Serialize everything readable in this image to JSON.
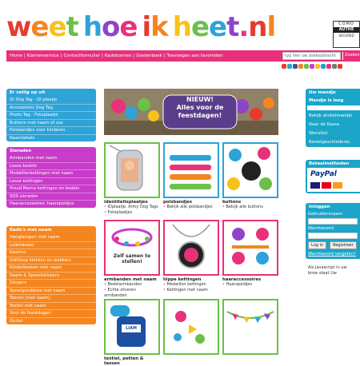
{
  "logo": {
    "letters": [
      {
        "t": "w",
        "c": "#e63b2e"
      },
      {
        "t": "e",
        "c": "#f5861f"
      },
      {
        "t": "e",
        "c": "#f7c21b"
      },
      {
        "t": "t",
        "c": "#6cc04a"
      },
      {
        "t": " ",
        "c": "#000"
      },
      {
        "t": "h",
        "c": "#2ea3d8"
      },
      {
        "t": "o",
        "c": "#8e44c9"
      },
      {
        "t": "e",
        "c": "#e8317a"
      },
      {
        "t": " ",
        "c": "#000"
      },
      {
        "t": "i",
        "c": "#e63b2e"
      },
      {
        "t": "k",
        "c": "#f5861f"
      },
      {
        "t": " ",
        "c": "#000"
      },
      {
        "t": "h",
        "c": "#f7c21b"
      },
      {
        "t": "e",
        "c": "#6cc04a"
      },
      {
        "t": "e",
        "c": "#2ea3d8"
      },
      {
        "t": "t",
        "c": "#8e44c9"
      },
      {
        "t": ".",
        "c": "#e8317a"
      },
      {
        "t": "n",
        "c": "#e63b2e"
      },
      {
        "t": "l",
        "c": "#f5861f"
      }
    ]
  },
  "seal": {
    "line1": "COMO",
    "line2": "AUTHE",
    "line3": "SECURED"
  },
  "nav": {
    "items": [
      "Home",
      "Klantenservice",
      "Contactformulier",
      "Kadobonnen",
      "Gastenboek",
      "Toevoegen aan favorieten"
    ]
  },
  "search": {
    "placeholder": "typ hier uw zoekopdracht",
    "button": "Zoeken"
  },
  "colors": {
    "pink": "#e8317a",
    "blue": "#2ea3d8",
    "orange": "#f5861f",
    "purple": "#c93bc9",
    "green": "#6cc04a"
  },
  "left": {
    "veilig": {
      "title": "Er veilig op uit",
      "items": [
        "ID Dog Tag - ID plaatje",
        "Accessoires Dog Tag",
        "Photo Tag - Fotoplaatje",
        "Buttons met naam of sos",
        "Polsbandjes voor kinderen",
        "Naamlabels"
      ]
    },
    "sieraden": {
      "title": "Sieraden",
      "items": [
        "Armbanden met naam",
        "Losse bedels",
        "Medaillonkettingen met naam",
        "Losse kettingen",
        "Proud Mama kettingen en bedels",
        "SOS sieraden",
        "Haaraccessoires: haarspeldjes"
      ]
    },
    "kado": {
      "title": "Kado's met naam",
      "items": [
        "Hanglampen met naam",
        "Luiertassen",
        "Kaarten",
        "KidSleep klokken en wekkers",
        "Kinderboeken met naam",
        "Naam & Spreukstickers",
        "Slingers",
        "Speelgoeddoos met naam",
        "Tassen (met naam)",
        "Textiel met naam",
        "Voor de feestdagen",
        "Outlet"
      ]
    }
  },
  "banner": {
    "line1": "NIEUW!",
    "line2": "Alles voor de",
    "line3": "feestdagen!"
  },
  "products": [
    {
      "title": "identiteitsplaatjes",
      "links": [
        "IDplaatje, Army Dog Tags",
        "Fotoplaatjes"
      ],
      "color": "green"
    },
    {
      "title": "polsbandjes",
      "links": [
        "Bekijk alle polsbandjes"
      ],
      "color": "blu"
    },
    {
      "title": "buttons",
      "links": [
        "Bekijk alle buttons"
      ],
      "color": "blu"
    },
    {
      "title": "armbanden met naam",
      "links": [
        "Bedelarmbanden",
        "Echte zilveren armbanden"
      ],
      "color": "pink",
      "caption": "Zelf samen te stellen!"
    },
    {
      "title": "hippe kettingen",
      "links": [
        "Medaillon kettingen",
        "Kettingen met naam"
      ],
      "color": "pink"
    },
    {
      "title": "haaraccessoires",
      "links": [
        "Haarspeldjes"
      ],
      "color": "pink"
    },
    {
      "title": "textiel, petten & tassen",
      "links": [],
      "color": "green",
      "caption": "LIAM"
    },
    {
      "title": "",
      "links": [],
      "color": "green"
    },
    {
      "title": "",
      "links": [],
      "color": "green"
    }
  ],
  "right": {
    "mandje": {
      "title": "Uw mandje",
      "status": "Mandje is leeg",
      "items": [
        "Bekijk winkelmandje",
        "Naar de Kassa",
        "Wenslijst",
        "Bestelgeschiedenis"
      ]
    },
    "betaal": {
      "title": "Betaalmethoden"
    },
    "inloggen": {
      "title": "Inloggen",
      "user_label": "Gebruikersnaam",
      "pass_label": "Wachtwoord",
      "login": "Log in",
      "register": "Registreer",
      "forgot": "Wachtwoord vergeten?"
    },
    "note": "Als Javascript in uw brow staat Uw"
  }
}
